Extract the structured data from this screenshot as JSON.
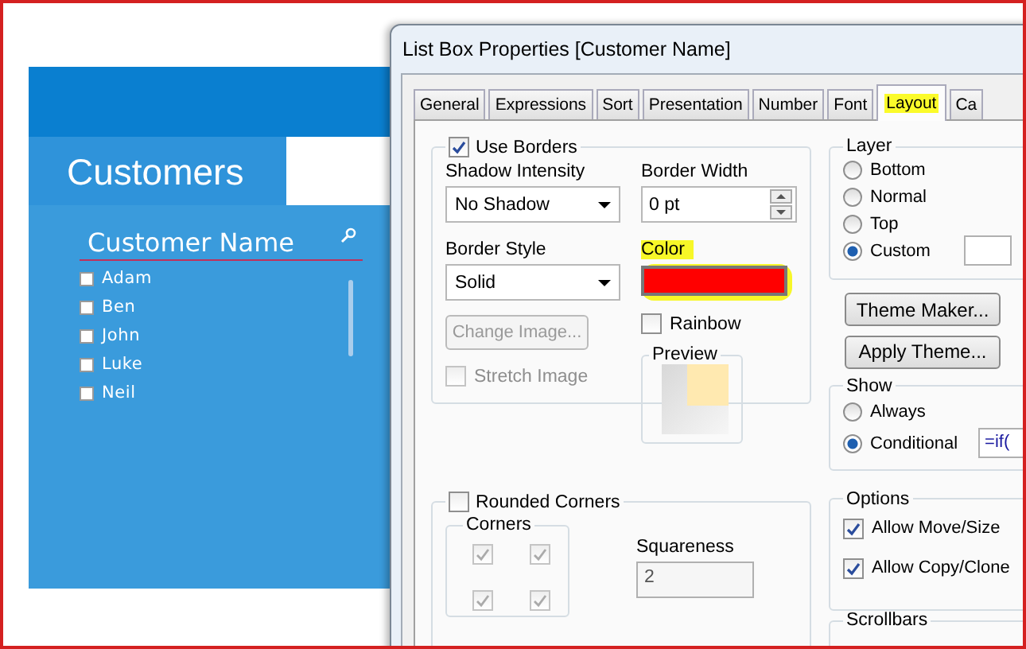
{
  "dashboard": {
    "header": "Customers",
    "listbox": {
      "title": "Customer Name",
      "items": [
        {
          "label": "Adam",
          "selected": false
        },
        {
          "label": "Ben",
          "selected": false
        },
        {
          "label": "John",
          "selected": false
        },
        {
          "label": "Luke",
          "selected": false
        },
        {
          "label": "Neil",
          "selected": false
        }
      ]
    }
  },
  "dialog": {
    "title": "List Box Properties [Customer Name]",
    "tabs": [
      {
        "label": "General",
        "selected": false
      },
      {
        "label": "Expressions",
        "selected": false
      },
      {
        "label": "Sort",
        "selected": false
      },
      {
        "label": "Presentation",
        "selected": false
      },
      {
        "label": "Number",
        "selected": false
      },
      {
        "label": "Font",
        "selected": false
      },
      {
        "label": "Layout",
        "selected": true,
        "highlighted": true
      },
      {
        "label": "Ca",
        "selected": false
      }
    ],
    "borders": {
      "use_borders": {
        "label": "Use Borders",
        "checked": true
      },
      "shadow_intensity": {
        "label": "Shadow Intensity",
        "value": "No Shadow"
      },
      "border_width": {
        "label": "Border Width",
        "value": "0 pt"
      },
      "border_style": {
        "label": "Border Style",
        "value": "Solid"
      },
      "color": {
        "label": "Color",
        "color": "#ff0000",
        "highlighted": true
      },
      "change_image": {
        "label": "Change Image...",
        "disabled": true
      },
      "rainbow": {
        "label": "Rainbow",
        "checked": false
      },
      "stretch_image": {
        "label": "Stretch Image",
        "checked": false,
        "disabled": true
      },
      "preview": {
        "label": "Preview"
      }
    },
    "rounded": {
      "rounded_corners": {
        "label": "Rounded Corners",
        "checked": false
      },
      "corners_label": "Corners",
      "corners": [
        {
          "checked": true,
          "disabled": true
        },
        {
          "checked": true,
          "disabled": true
        },
        {
          "checked": true,
          "disabled": true
        },
        {
          "checked": true,
          "disabled": true
        }
      ],
      "squareness": {
        "label": "Squareness",
        "value": "2",
        "disabled": true
      }
    },
    "layer": {
      "label": "Layer",
      "options": [
        {
          "label": "Bottom",
          "selected": false
        },
        {
          "label": "Normal",
          "selected": false
        },
        {
          "label": "Top",
          "selected": false
        },
        {
          "label": "Custom",
          "selected": true
        }
      ]
    },
    "buttons": [
      "Theme Maker...",
      "Apply Theme..."
    ],
    "show": {
      "label": "Show",
      "options": [
        {
          "label": "Always",
          "selected": false
        },
        {
          "label": "Conditional",
          "selected": true
        }
      ],
      "condition": "=if("
    },
    "options": {
      "label": "Options",
      "items": [
        {
          "label": "Allow Move/Size",
          "checked": true
        },
        {
          "label": "Allow Copy/Clone",
          "checked": true
        }
      ]
    },
    "scrollbars": {
      "label": "Scrollbars"
    }
  }
}
